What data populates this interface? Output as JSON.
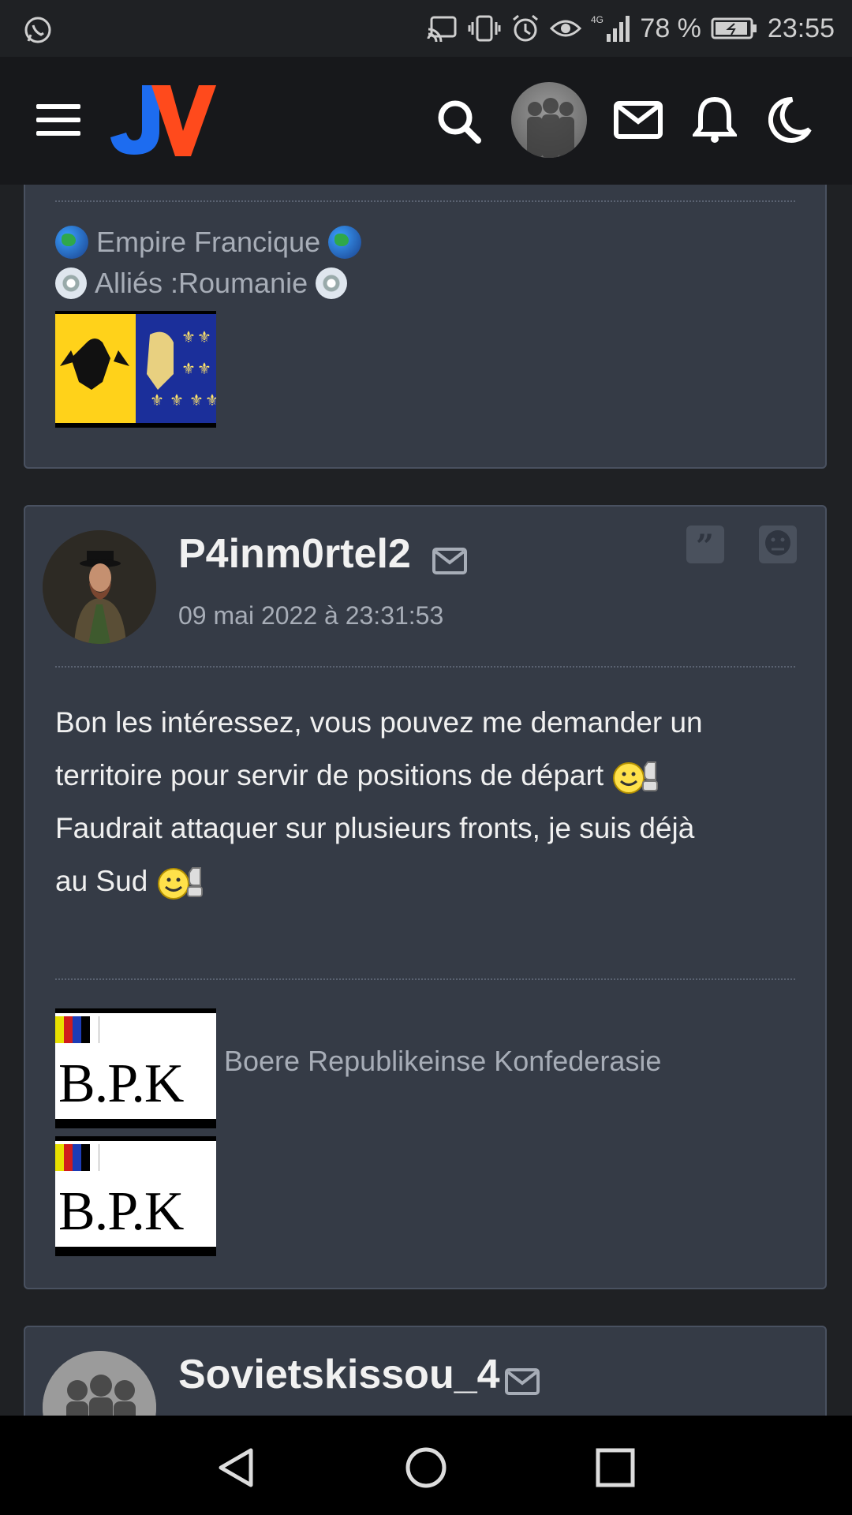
{
  "status": {
    "battery_percent": "78 %",
    "time": "23:55"
  },
  "header": {
    "logo_text": "JV"
  },
  "prev_post": {
    "sig_line1": "Empire Francique",
    "sig_line2": "Alliés :Roumanie"
  },
  "post": {
    "username": "P4inm0rtel2",
    "date": "09 mai 2022 à 23:31:53",
    "text_line1": "Bon les intéressez, vous pouvez me demander un",
    "text_line2": "territoire pour servir de positions de départ",
    "text_line3": "Faudrait attaquer sur plusieurs fronts, je suis déjà",
    "text_line4": "au Sud",
    "sig_badge_text": "B.P.K",
    "sig_label": "Boere Republikeinse Konfederasie"
  },
  "next_post": {
    "username": "Sovietskissou_4"
  },
  "colors": {
    "card_bg": "#353b46",
    "header_bg": "#17181b",
    "logo_blue": "#1d6cf0",
    "logo_red": "#ff4a1c"
  }
}
